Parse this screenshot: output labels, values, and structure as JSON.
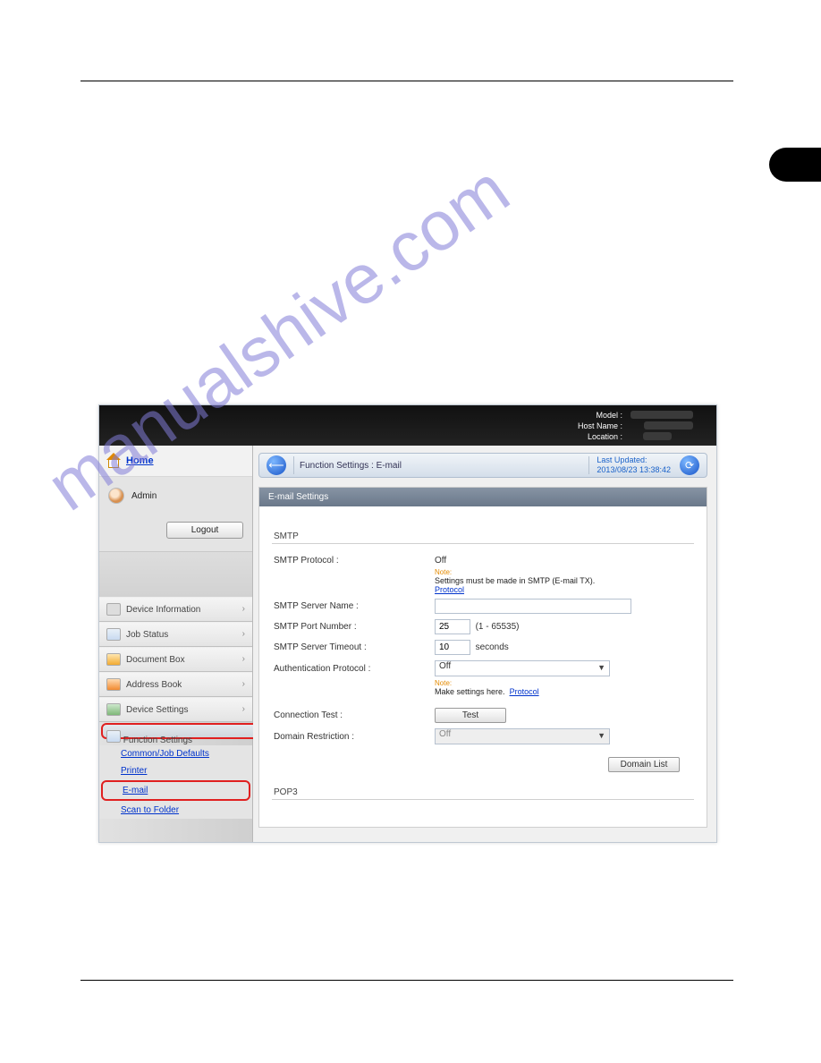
{
  "header": {
    "model_label": "Model :",
    "host_label": "Host Name :",
    "location_label": "Location :"
  },
  "sidebar": {
    "home": "Home",
    "user": "Admin",
    "logout": "Logout",
    "items": [
      {
        "label": "Device Information"
      },
      {
        "label": "Job Status"
      },
      {
        "label": "Document Box"
      },
      {
        "label": "Address Book"
      },
      {
        "label": "Device Settings"
      },
      {
        "label": "Function Settings"
      }
    ],
    "sub": [
      {
        "label": "Common/Job Defaults"
      },
      {
        "label": "Printer"
      },
      {
        "label": "E-mail"
      },
      {
        "label": "Scan to Folder"
      }
    ]
  },
  "crumb": {
    "title": "Function Settings : E-mail",
    "updated_label": "Last Updated:",
    "updated_value": "2013/08/23 13:38:42"
  },
  "panel": {
    "title": "E-mail Settings",
    "smtp": {
      "section": "SMTP",
      "proto_label": "SMTP Protocol :",
      "proto_value": "Off",
      "note1_head": "Note:",
      "note1_body": "Settings must be made in SMTP (E-mail TX).",
      "proto_link": "Protocol",
      "server_name_label": "SMTP Server Name :",
      "server_name_value": "",
      "port_label": "SMTP Port Number :",
      "port_value": "25",
      "port_hint": "(1 - 65535)",
      "timeout_label": "SMTP Server Timeout :",
      "timeout_value": "10",
      "timeout_unit": "seconds",
      "auth_label": "Authentication Protocol :",
      "auth_value": "Off",
      "note2_head": "Note:",
      "note2_body": "Make settings here.",
      "conn_label": "Connection Test :",
      "conn_btn": "Test",
      "restrict_label": "Domain Restriction :",
      "restrict_value": "Off",
      "domain_btn": "Domain List"
    },
    "pop3_section": "POP3"
  },
  "watermark": "manualshive.com"
}
